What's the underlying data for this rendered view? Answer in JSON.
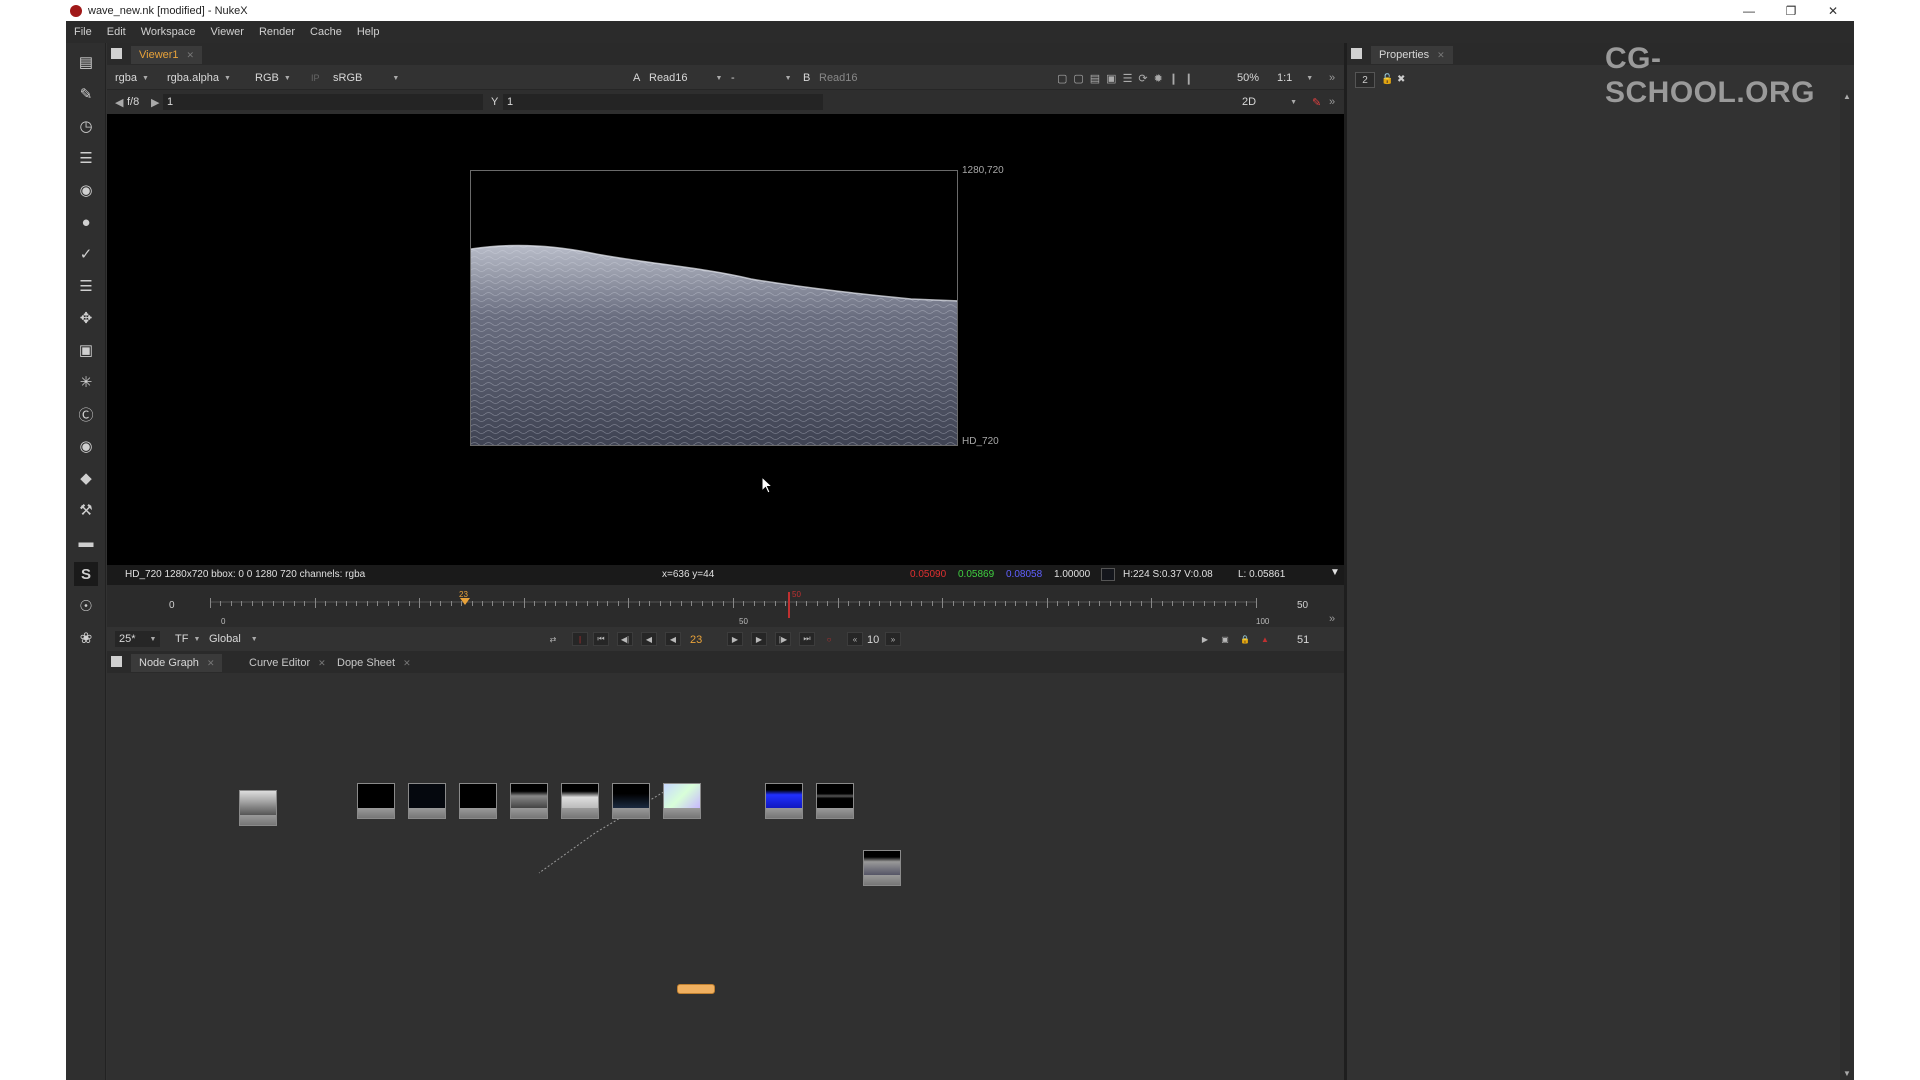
{
  "window": {
    "title": "wave_new.nk [modified] - NukeX",
    "controls": [
      "minimize-icon",
      "restore-icon",
      "close-icon"
    ]
  },
  "menu": [
    "File",
    "Edit",
    "Workspace",
    "Viewer",
    "Render",
    "Cache",
    "Help"
  ],
  "left_toolbar": [
    "image-icon",
    "draw-icon",
    "time-icon",
    "channel-icon",
    "color-icon",
    "filter-icon",
    "keyer-icon",
    "merge-icon",
    "transform-icon",
    "3d-icon",
    "particles-icon",
    "deep-icon",
    "views-icon",
    "metadata-icon",
    "toolsets-icon",
    "other-icon",
    "script-icon",
    "furnace-icon",
    "ocula-icon"
  ],
  "viewer": {
    "tab_label": "Viewer1",
    "channels": "rgba",
    "alpha_channel": "rgba.alpha",
    "display_channel": "RGB",
    "ip_label": "IP",
    "colorspace": "sRGB",
    "input_a_label": "A",
    "input_a": "Read16",
    "merge_op": "-",
    "input_b_label": "B",
    "input_b": "Read16",
    "zoom": "50%",
    "ratio": "1:1",
    "fstop": "f/8",
    "gain": "1",
    "y_label": "Y",
    "gamma": "1",
    "view_mode": "2D",
    "resolution_label": "1280,720",
    "format_label": "HD_720"
  },
  "info_bar": {
    "format_info": "HD_720 1280x720  bbox: 0 0 1280 720 channels: rgba",
    "coords": "x=636 y=44",
    "r": "0.05090",
    "g": "0.05869",
    "b": "0.08058",
    "a": "1.00000",
    "hsv": "H:224 S:0.37 V:0.08",
    "lum": "L: 0.05861",
    "colors": {
      "r": "#e03030",
      "g": "#40d040",
      "b": "#6060ff"
    }
  },
  "timeline": {
    "start": "0",
    "end": "50",
    "ruler_start": "0",
    "ruler_mid": "50",
    "ruler_end": "100",
    "in_marker": "23",
    "current_marker": "50",
    "fps": "25*",
    "tf": "TF",
    "scope": "Global",
    "current_frame": "23",
    "step": "10",
    "last_frame": "51"
  },
  "node_graph_tabs": [
    "Node Graph",
    "Curve Editor",
    "Dope Sheet"
  ],
  "properties": {
    "tab_label": "Properties",
    "max_panels": "2"
  },
  "watermark": "CG-SCHOOL.ORG"
}
